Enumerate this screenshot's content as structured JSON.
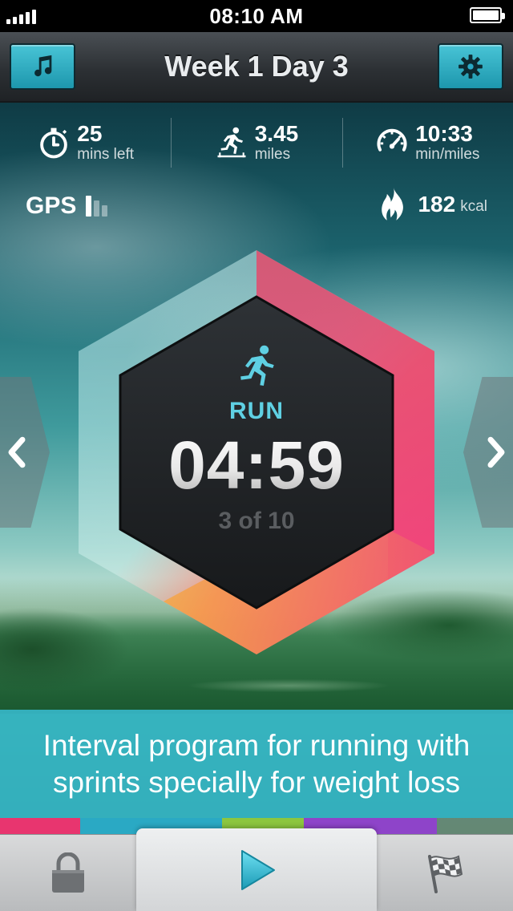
{
  "status_bar": {
    "time": "08:10 AM"
  },
  "nav": {
    "title": "Week 1 Day 3",
    "left_icon": "music-note-icon",
    "right_icon": "gear-icon"
  },
  "stats": [
    {
      "icon": "stopwatch-icon",
      "value": "25",
      "unit": "mins left"
    },
    {
      "icon": "runner-icon",
      "value": "3.45",
      "unit": "miles"
    },
    {
      "icon": "speedometer-icon",
      "value": "10:33",
      "unit": "min/miles"
    }
  ],
  "gps": {
    "label": "GPS",
    "signal_bars_active": 1,
    "signal_bars_total": 3
  },
  "calories": {
    "value": "182",
    "unit": "kcal",
    "icon": "flame-icon"
  },
  "workout": {
    "phase": "RUN",
    "timer": "04:59",
    "progress": "3 of 10",
    "phase_icon": "running-man-icon"
  },
  "description": "Interval program for running with sprints specially for weight loss",
  "color_strip": [
    "#e8356f",
    "#2aa9c4",
    "#8cc63f",
    "#8e44c9",
    "#cfd3d5"
  ],
  "tabs": [
    {
      "icon": "lock-icon"
    },
    {
      "icon": "play-icon"
    },
    {
      "icon": "checkered-flag-icon"
    }
  ],
  "colors": {
    "accent": "#2aa9c4",
    "hex_gradient_start": "#9fe6ee",
    "hex_gradient_end": "#e8356f"
  }
}
